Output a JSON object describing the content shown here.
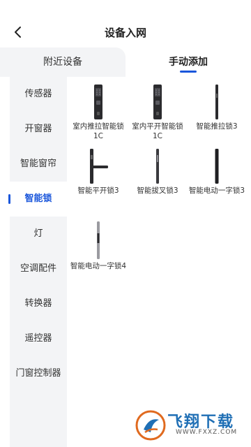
{
  "header": {
    "title": "设备入网"
  },
  "tabs": [
    {
      "label": "附近设备"
    },
    {
      "label": "手动添加"
    }
  ],
  "sidebar": {
    "items": [
      {
        "label": "传感器"
      },
      {
        "label": "开窗器"
      },
      {
        "label": "智能窗帘"
      },
      {
        "label": "智能锁"
      },
      {
        "label": "灯"
      },
      {
        "label": "空调配件"
      },
      {
        "label": "转换器"
      },
      {
        "label": "遥控器"
      },
      {
        "label": "门窗控制器"
      }
    ],
    "active": "智能锁"
  },
  "devices": [
    {
      "label": "室内推拉智能锁1C",
      "icon": "keypad-lock-icon"
    },
    {
      "label": "室内平开智能锁1C",
      "icon": "keypad-lock-icon"
    },
    {
      "label": "智能推拉锁3",
      "icon": "slim-lock-icon"
    },
    {
      "label": "智能平开锁3",
      "icon": "lever-lock-icon"
    },
    {
      "label": "智能拔叉锁3",
      "icon": "slim-lock-icon"
    },
    {
      "label": "智能电动一字锁3",
      "icon": "slim-lock-icon"
    },
    {
      "label": "智能电动一字锁4",
      "icon": "slim-lock-icon"
    }
  ],
  "watermark": {
    "main": "飞翔下载",
    "sub": "WWW.FXXZ.COM"
  },
  "colors": {
    "accent": "#1a56db",
    "sidebar_bg": "#f3f4f6"
  }
}
